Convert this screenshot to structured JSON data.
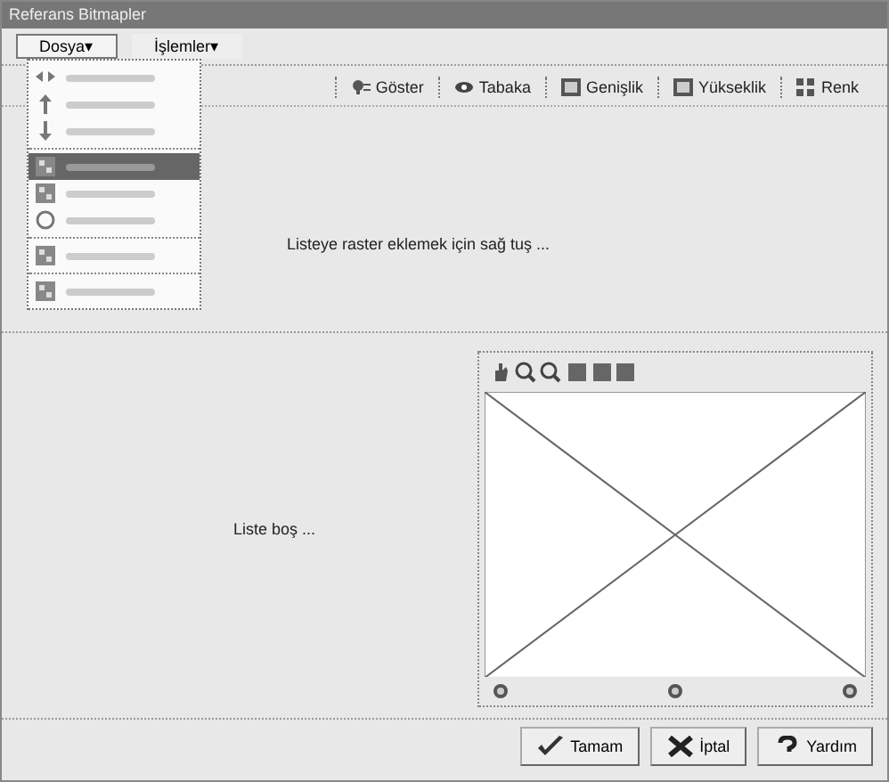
{
  "window": {
    "title": "Referans Bitmapler"
  },
  "menubar": [
    {
      "label": "Dosya▾",
      "selected": true
    },
    {
      "label": "İşlemler▾",
      "selected": false
    }
  ],
  "dropdown": [
    {
      "kind": "item",
      "selected": false
    },
    {
      "kind": "item",
      "selected": false
    },
    {
      "kind": "item",
      "selected": false
    },
    {
      "kind": "separator"
    },
    {
      "kind": "item",
      "selected": true
    },
    {
      "kind": "item",
      "selected": false
    },
    {
      "kind": "item",
      "selected": false
    },
    {
      "kind": "separator"
    },
    {
      "kind": "item",
      "selected": false
    },
    {
      "kind": "separator"
    },
    {
      "kind": "item",
      "selected": false
    }
  ],
  "columns": [
    "Göster",
    "Tabaka",
    "Genişlik",
    "Yükseklik",
    "Renk"
  ],
  "top_hint": "Listeye raster eklemek için sağ tuş ...",
  "list_empty": "Liste boş ...",
  "buttons": [
    {
      "kind": "ok",
      "label": "Tamam"
    },
    {
      "kind": "cancel",
      "label": "İptal"
    },
    {
      "kind": "help",
      "label": "Yardım"
    }
  ]
}
